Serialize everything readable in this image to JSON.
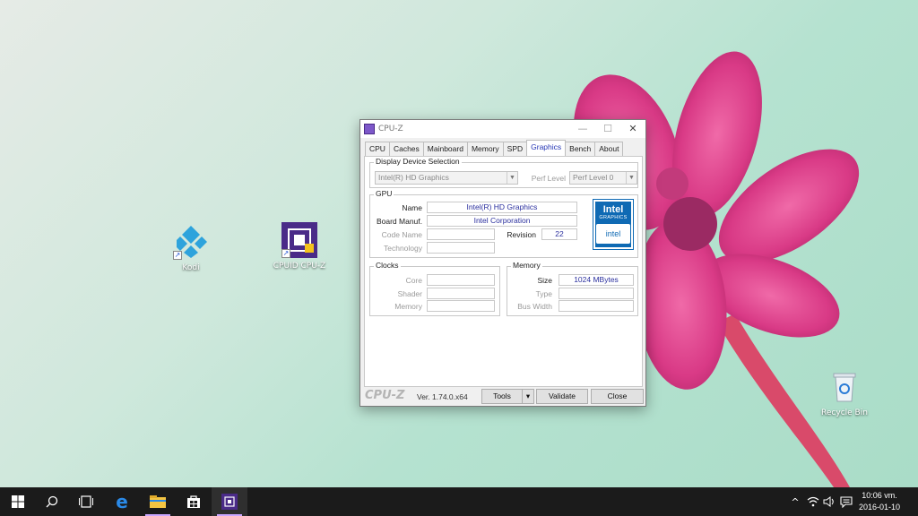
{
  "desktop": {
    "icons": [
      {
        "label": "Kodi",
        "icon": "kodi-icon"
      },
      {
        "label": "CPUID CPU-Z",
        "icon": "cpuz-icon"
      },
      {
        "label": "Recycle Bin",
        "icon": "recycle-bin-icon"
      }
    ]
  },
  "window": {
    "title": "CPU-Z",
    "controls": {
      "minimize": "—",
      "maximize": "☐",
      "close": "✕"
    },
    "tabs": [
      "CPU",
      "Caches",
      "Mainboard",
      "Memory",
      "SPD",
      "Graphics",
      "Bench",
      "About"
    ],
    "active_tab": "Graphics",
    "display_device": {
      "legend": "Display Device Selection",
      "device": "Intel(R) HD Graphics",
      "perf_label": "Perf Level",
      "perf_value": "Perf Level 0"
    },
    "gpu": {
      "legend": "GPU",
      "name_label": "Name",
      "name": "Intel(R) HD Graphics",
      "board_label": "Board Manuf.",
      "board": "Intel Corporation",
      "code_label": "Code Name",
      "code": "",
      "revision_label": "Revision",
      "revision": "22",
      "tech_label": "Technology",
      "tech": "",
      "logo": {
        "brand": "Intel",
        "sub": "GRAPHICS",
        "inner": "intel"
      }
    },
    "clocks": {
      "legend": "Clocks",
      "core_label": "Core",
      "core": "",
      "shader_label": "Shader",
      "shader": "",
      "memory_label": "Memory",
      "memory": ""
    },
    "memory": {
      "legend": "Memory",
      "size_label": "Size",
      "size": "1024 MBytes",
      "type_label": "Type",
      "type": "",
      "bus_label": "Bus Width",
      "bus": ""
    },
    "footer": {
      "brand": "CPU-Z",
      "version": "Ver. 1.74.0.x64",
      "tools": "Tools",
      "validate": "Validate",
      "close": "Close"
    }
  },
  "taskbar": {
    "clock_time": "10:06 vm.",
    "clock_date": "2016-01-10"
  },
  "colors": {
    "accent": "#2536b5",
    "taskbar": "#1b1b1b",
    "intel_blue": "#0f6ab4"
  }
}
